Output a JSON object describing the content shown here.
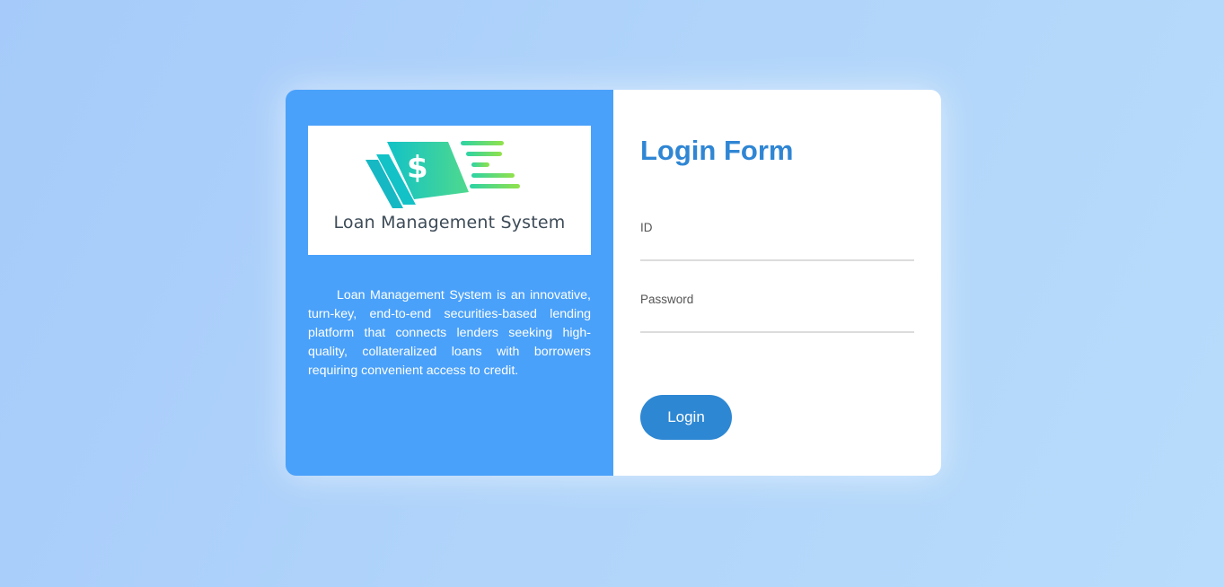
{
  "brand": {
    "logo_text": "Loan Management System",
    "description": "Loan Management System is an innovative, turn-key, end-to-end securities-based lending platform that connects lenders seeking high-quality, collateralized loans with borrowers requiring convenient access to credit."
  },
  "form": {
    "title": "Login Form",
    "id_label": "ID",
    "id_value": "",
    "password_label": "Password",
    "password_value": "",
    "login_label": "Login"
  },
  "colors": {
    "left_panel": "#4aa1fa",
    "title": "#2f86d4",
    "button": "#2d87d3",
    "logo_gradient_start": "#1ec8c8",
    "logo_gradient_end": "#8be04a"
  }
}
